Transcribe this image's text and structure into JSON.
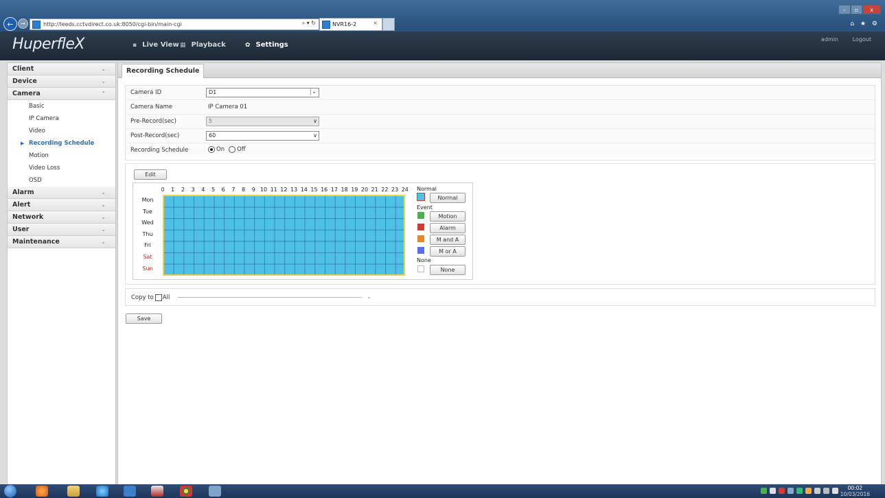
{
  "browser": {
    "url": "http://leeds.cctvdirect.co.uk:8050/cgi-bin/main-cgi",
    "search_refresh": "⌕ ▾ ↻",
    "tab_title": "NVR16-2",
    "tab_close": "×",
    "window_controls": [
      "–",
      "▫",
      "x"
    ],
    "toolbar_icons": "⌂ ★ ⚙"
  },
  "header": {
    "logo": "HuperfleX",
    "nav": [
      {
        "label": "Live View",
        "icon": "monitor-icon"
      },
      {
        "label": "Playback",
        "icon": "film-icon"
      },
      {
        "label": "Settings",
        "icon": "gear-icon"
      }
    ],
    "user": "admin",
    "logout": "Logout"
  },
  "sidebar": {
    "sections": [
      {
        "label": "Client",
        "expanded": false
      },
      {
        "label": "Device",
        "expanded": false
      },
      {
        "label": "Camera",
        "expanded": true
      },
      {
        "label": "Alarm",
        "expanded": false
      },
      {
        "label": "Alert",
        "expanded": false
      },
      {
        "label": "Network",
        "expanded": false
      },
      {
        "label": "User",
        "expanded": false
      },
      {
        "label": "Maintenance",
        "expanded": false
      }
    ],
    "camera_items": [
      "Basic",
      "IP Camera",
      "Video",
      "Recording Schedule",
      "Motion",
      "Video Loss",
      "OSD"
    ],
    "active_item": "Recording Schedule",
    "chevron_collapsed": "⌄",
    "chevron_expanded": "⌃"
  },
  "page": {
    "tab": "Recording Schedule",
    "fields": {
      "camera_id_label": "Camera ID",
      "camera_id_value": "D1",
      "camera_name_label": "Camera Name",
      "camera_name_value": "IP Camera 01",
      "pre_record_label": "Pre-Record(sec)",
      "pre_record_value": "5",
      "post_record_label": "Post-Record(sec)",
      "post_record_value": "60",
      "schedule_label": "Recording Schedule",
      "schedule_on": "On",
      "schedule_off": "Off",
      "schedule_selected": "On"
    },
    "edit_button": "Edit",
    "hours": [
      "0",
      "1",
      "2",
      "3",
      "4",
      "5",
      "6",
      "7",
      "8",
      "9",
      "10",
      "11",
      "12",
      "13",
      "14",
      "15",
      "16",
      "17",
      "18",
      "19",
      "20",
      "21",
      "22",
      "23",
      "24"
    ],
    "days": [
      "Mon",
      "Tue",
      "Wed",
      "Thu",
      "Fri",
      "Sat",
      "Sun"
    ],
    "weekend_days": [
      "Sat",
      "Sun"
    ],
    "legend": {
      "normal_title": "Normal",
      "normal_button": "Normal",
      "event_title": "Event",
      "motion_button": "Motion",
      "alarm_button": "Alarm",
      "m_and_a_button": "M and A",
      "m_or_a_button": "M or A",
      "none_title": "None",
      "none_button": "None"
    },
    "colors": {
      "normal": "#4fc0e6",
      "motion": "#4caf50",
      "alarm": "#d13b30",
      "m_and_a": "#e8862a",
      "m_or_a": "#5b6cf0",
      "grid_border": "#e8d44a"
    },
    "copy_to_label": "Copy to",
    "copy_all_label": "All",
    "save_button": "Save"
  },
  "taskbar": {
    "clock_time": "00:02",
    "clock_date": "10/03/2016"
  }
}
